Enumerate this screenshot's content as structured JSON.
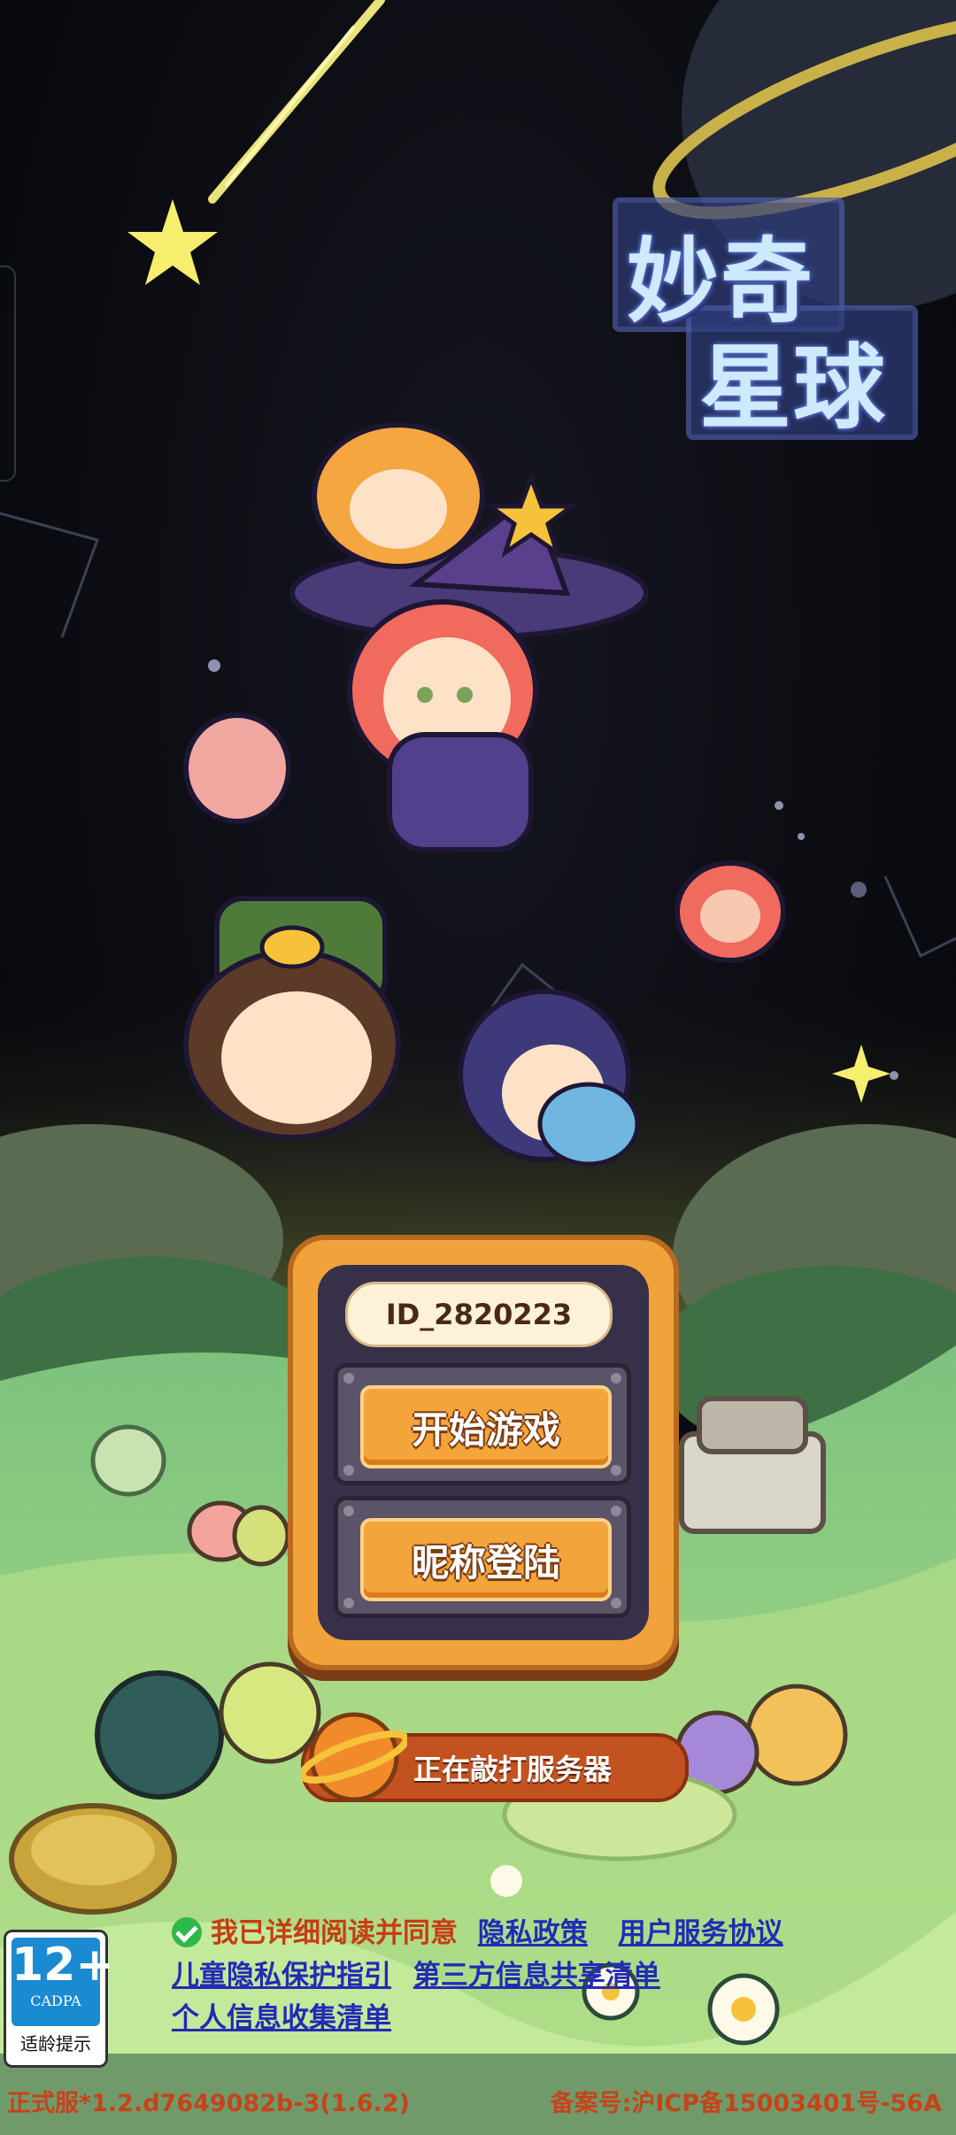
{
  "logo": {
    "line1": "妙奇",
    "line2": "星球"
  },
  "login": {
    "user_id": "ID_2820223",
    "start_button": "开始游戏",
    "nickname_button": "昵称登陆"
  },
  "loading": {
    "status": "正在敲打服务器"
  },
  "agreement": {
    "checked": true,
    "prefix": "我已详细阅读并同意",
    "privacy_policy": "隐私政策",
    "user_agreement": "用户服务协议",
    "children_privacy": "儿童隐私保护指引",
    "third_party_list": "第三方信息共享清单",
    "personal_info_list": "个人信息收集清单"
  },
  "age_rating": {
    "rating": "12+",
    "org": "CADPA",
    "label": "适龄提示"
  },
  "footer": {
    "version": "正式服*1.2.d7649082b-3(1.6.2)",
    "icp": "备案号:沪ICP备15003401号-56A"
  },
  "colors": {
    "accent": "#f3a43a",
    "link": "#232bb5",
    "warning_text": "#c73d13"
  }
}
